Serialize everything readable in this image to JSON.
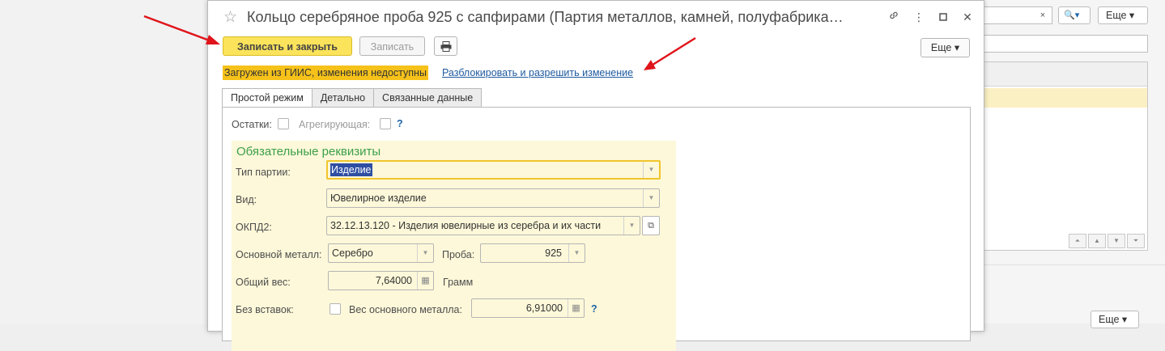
{
  "window": {
    "title": "Кольцо серебряное проба 925 с сапфирами (Партия металлов, камней, полуфабрика…"
  },
  "toolbar": {
    "save_close_label": "Записать и закрыть",
    "save_label": "Записать",
    "more_label": "Еще"
  },
  "notice": {
    "text": "Загружен из ГИИС, изменения недоступны",
    "unlock_link": "Разблокировать и разрешить изменение"
  },
  "tabs": [
    {
      "label": "Простой режим"
    },
    {
      "label": "Детально"
    },
    {
      "label": "Связанные данные"
    }
  ],
  "flags": {
    "ostatki_label": "Остатки:",
    "agregir_label": "Агрегирующая:",
    "help": "?"
  },
  "required": {
    "title": "Обязательные реквизиты",
    "party_type": {
      "label": "Тип партии:",
      "value": "Изделие"
    },
    "vid": {
      "label": "Вид:",
      "value": "Ювелирное изделие"
    },
    "okpd2": {
      "label": "ОКПД2:",
      "value": "32.12.13.120 - Изделия ювелирные из серебра и их части"
    },
    "main_metal": {
      "label": "Основной металл:",
      "value": "Серебро"
    },
    "proba": {
      "label": "Проба:",
      "value": "925"
    },
    "total_weight": {
      "label": "Общий вес:",
      "value": "7,64000",
      "unit": "Грамм"
    },
    "no_inserts": {
      "label": "Без вставок:"
    },
    "main_metal_weight": {
      "label": "Вес основного металла:",
      "value": "6,91000",
      "help": "?"
    }
  },
  "background": {
    "more_label": "Еще",
    "clear": "×"
  },
  "colors": {
    "primary_button": "#fbe35b",
    "notice_bg": "#f6c21a",
    "group_bg": "#fdf8d9",
    "group_title": "#3ba04a",
    "link": "#1f5aa0",
    "arrow": "#e0141b"
  }
}
